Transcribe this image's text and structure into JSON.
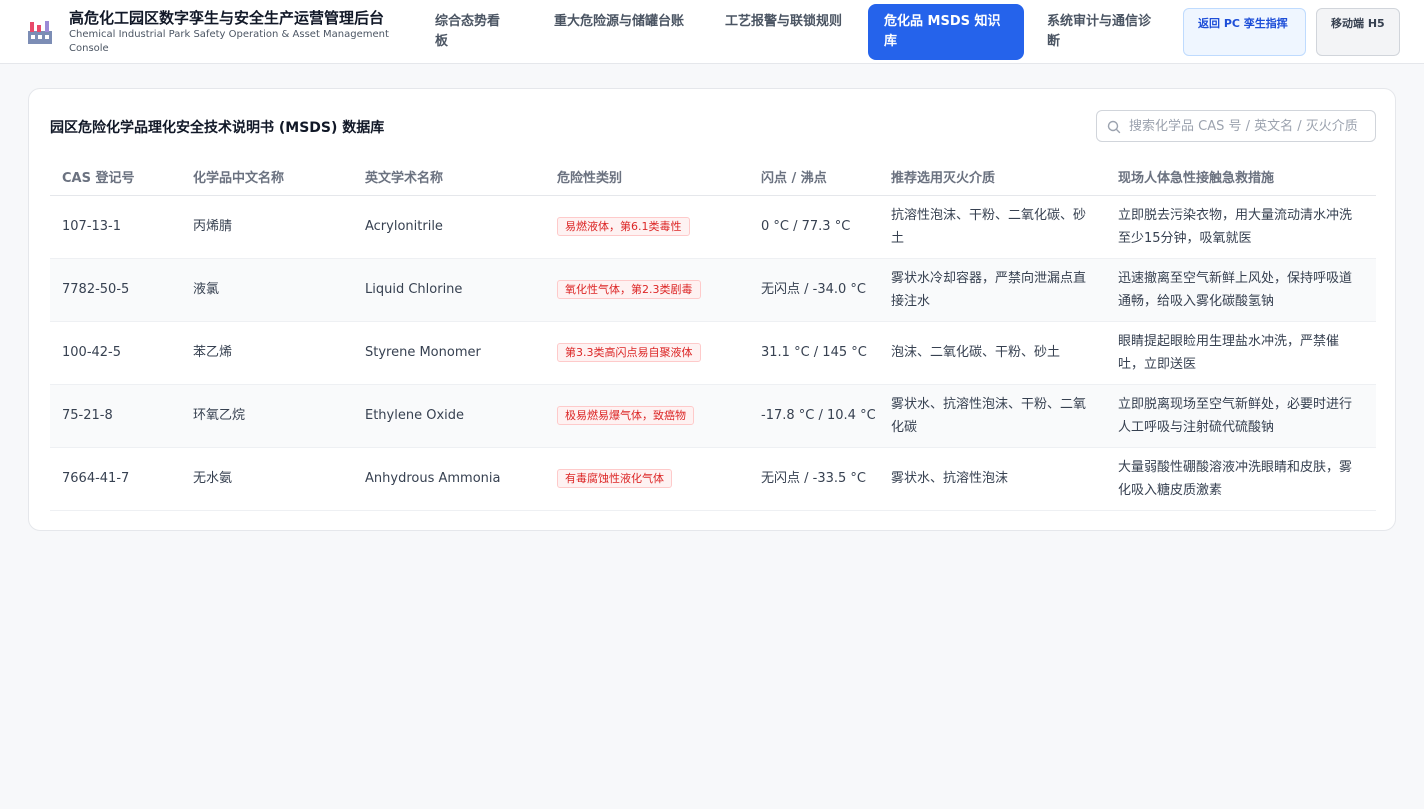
{
  "header": {
    "title": "高危化工园区数字孪生与安全生产运营管理后台",
    "subtitle": "Chemical Industrial Park Safety Operation & Asset Management Console",
    "tabs": [
      {
        "label": "综合态势看板"
      },
      {
        "label": "重大危险源与储罐台账"
      },
      {
        "label": "工艺报警与联锁规则"
      },
      {
        "label": "危化品 MSDS 知识库"
      },
      {
        "label": "系统审计与通信诊断"
      }
    ],
    "active_tab": 3,
    "pc_button": "返回 PC 孪生指挥",
    "h5_button": "移动端 H5"
  },
  "card": {
    "title": "园区危险化学品理化安全技术说明书 (MSDS) 数据库",
    "search_placeholder": "搜索化学品 CAS 号 / 英文名 / 灭火介质"
  },
  "table": {
    "columns": [
      "CAS 登记号",
      "化学品中文名称",
      "英文学术名称",
      "危险性类别",
      "闪点 / 沸点",
      "推荐选用灭火介质",
      "现场人体急性接触急救措施"
    ],
    "rows": [
      {
        "cas": "107-13-1",
        "cn": "丙烯腈",
        "en": "Acrylonitrile",
        "hazard": "易燃液体，第6.1类毒性",
        "flash": "0 °C / 77.3 °C",
        "fire": "抗溶性泡沫、干粉、二氧化碳、砂土",
        "aid": "立即脱去污染衣物，用大量流动清水冲洗至少15分钟，吸氧就医"
      },
      {
        "cas": "7782-50-5",
        "cn": "液氯",
        "en": "Liquid Chlorine",
        "hazard": "氧化性气体，第2.3类剧毒",
        "flash": "无闪点 / -34.0 °C",
        "fire": "雾状水冷却容器，严禁向泄漏点直接注水",
        "aid": "迅速撤离至空气新鲜上风处，保持呼吸道通畅，给吸入雾化碳酸氢钠"
      },
      {
        "cas": "100-42-5",
        "cn": "苯乙烯",
        "en": "Styrene Monomer",
        "hazard": "第3.3类高闪点易自聚液体",
        "flash": "31.1 °C / 145 °C",
        "fire": "泡沫、二氧化碳、干粉、砂土",
        "aid": "眼睛提起眼睑用生理盐水冲洗，严禁催吐，立即送医"
      },
      {
        "cas": "75-21-8",
        "cn": "环氧乙烷",
        "en": "Ethylene Oxide",
        "hazard": "极易燃易爆气体，致癌物",
        "flash": "-17.8 °C / 10.4 °C",
        "fire": "雾状水、抗溶性泡沫、干粉、二氧化碳",
        "aid": "立即脱离现场至空气新鲜处，必要时进行人工呼吸与注射硫代硫酸钠"
      },
      {
        "cas": "7664-41-7",
        "cn": "无水氨",
        "en": "Anhydrous Ammonia",
        "hazard": "有毒腐蚀性液化气体",
        "flash": "无闪点 / -33.5 °C",
        "fire": "雾状水、抗溶性泡沫",
        "aid": "大量弱酸性硼酸溶液冲洗眼睛和皮肤，雾化吸入糖皮质激素"
      }
    ]
  },
  "colors": {
    "accent": "#2563eb",
    "hazard_text": "#dc2626",
    "hazard_bg": "#fef2f2"
  }
}
